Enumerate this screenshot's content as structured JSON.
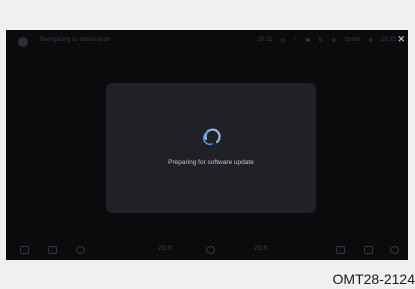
{
  "status_bar": {
    "title": "Navigating to destination",
    "right_items": [
      "20:11",
      "◎",
      "◔",
      "✱",
      "⇅",
      "⊕",
      "Sprint",
      "⊗",
      "10:22"
    ],
    "close_label": "✕"
  },
  "dialog": {
    "message": "Preparing for software update"
  },
  "bottom_bar": {
    "temp_left": "20.0",
    "temp_right": "20.5"
  },
  "figure_code": "OMT28-2124"
}
